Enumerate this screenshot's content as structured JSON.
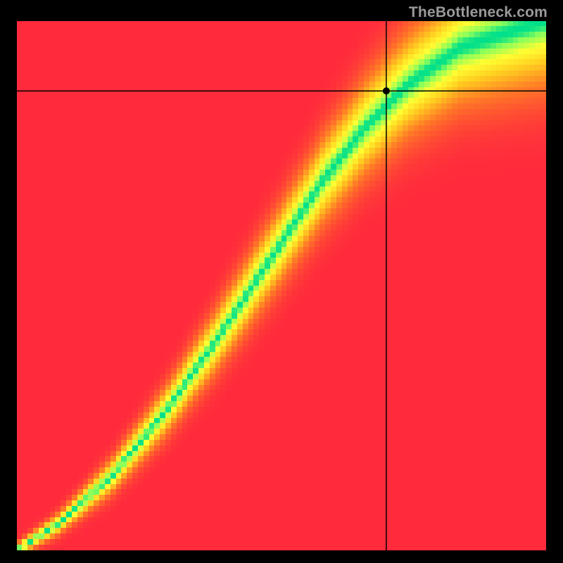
{
  "watermark": "TheBottleneck.com",
  "chart_data": {
    "type": "heatmap",
    "title": "",
    "xlabel": "",
    "ylabel": "",
    "xlim": [
      0,
      1
    ],
    "ylim": [
      0,
      1
    ],
    "crosshair": {
      "x": 0.698,
      "y": 0.868
    },
    "marker": {
      "x": 0.698,
      "y": 0.868,
      "color": "#000000"
    },
    "colorscale": [
      {
        "stop": 0.0,
        "color": "#ff2a3c"
      },
      {
        "stop": 0.4,
        "color": "#ff7a26"
      },
      {
        "stop": 0.7,
        "color": "#ffd020"
      },
      {
        "stop": 0.88,
        "color": "#ffff33"
      },
      {
        "stop": 0.97,
        "color": "#8cff5a"
      },
      {
        "stop": 1.0,
        "color": "#00e08a"
      }
    ],
    "ridge": {
      "points": [
        {
          "x": 0.0,
          "y": 0.0
        },
        {
          "x": 0.08,
          "y": 0.05
        },
        {
          "x": 0.18,
          "y": 0.14
        },
        {
          "x": 0.28,
          "y": 0.26
        },
        {
          "x": 0.38,
          "y": 0.4
        },
        {
          "x": 0.48,
          "y": 0.55
        },
        {
          "x": 0.58,
          "y": 0.7
        },
        {
          "x": 0.66,
          "y": 0.8
        },
        {
          "x": 0.74,
          "y": 0.88
        },
        {
          "x": 0.84,
          "y": 0.95
        },
        {
          "x": 1.0,
          "y": 1.0
        }
      ],
      "width_profile": [
        {
          "x": 0.0,
          "w": 0.008
        },
        {
          "x": 0.1,
          "w": 0.015
        },
        {
          "x": 0.25,
          "w": 0.028
        },
        {
          "x": 0.45,
          "w": 0.045
        },
        {
          "x": 0.65,
          "w": 0.06
        },
        {
          "x": 0.85,
          "w": 0.075
        },
        {
          "x": 1.0,
          "w": 0.085
        }
      ]
    },
    "grid_resolution": 96
  }
}
